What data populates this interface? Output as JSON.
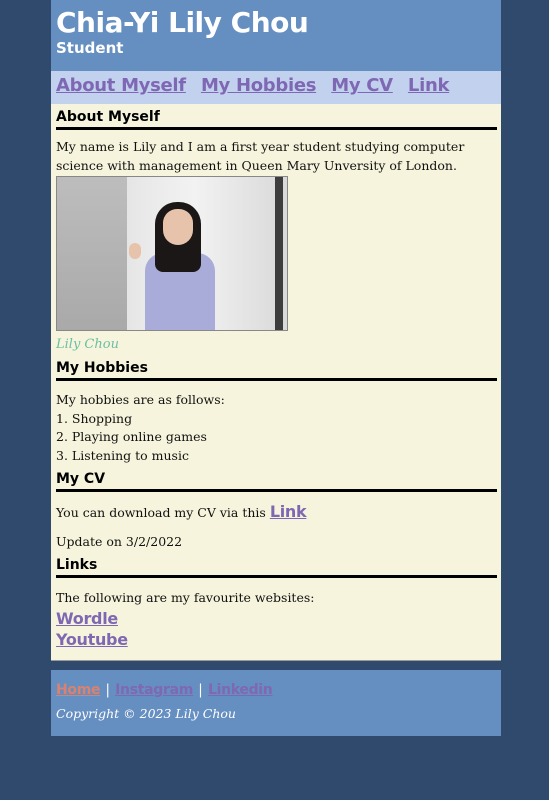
{
  "header": {
    "title": "Chia-Yi Lily Chou",
    "subtitle": "Student"
  },
  "nav": {
    "items": [
      "About Myself",
      "My Hobbies",
      "My CV",
      "Link"
    ]
  },
  "about": {
    "heading": "About Myself",
    "text": "My name is Lily and I am a first year student studying computer science with management in Queen Mary Unversity of London.",
    "caption": "Lily Chou"
  },
  "hobbies": {
    "heading": "My Hobbies",
    "intro": "My hobbies are as follows:",
    "items": [
      "1. Shopping",
      "2. Playing online games",
      "3. Listening to music"
    ]
  },
  "cv": {
    "heading": "My CV",
    "text": "You can download my CV via this",
    "link": "Link",
    "update": "Update on 3/2/2022"
  },
  "links": {
    "heading": "Links",
    "intro": "The following are my favourite websites:",
    "items": [
      "Wordle",
      "Youtube"
    ]
  },
  "footer": {
    "links": [
      {
        "label": "Home",
        "color": "#d9826f"
      },
      {
        "label": "Instagram",
        "color": "#7f68b3"
      },
      {
        "label": "Linkedin",
        "color": "#7f68b3"
      }
    ],
    "separator": "|",
    "copyright": "Copyright © 2023 Lily Chou"
  }
}
